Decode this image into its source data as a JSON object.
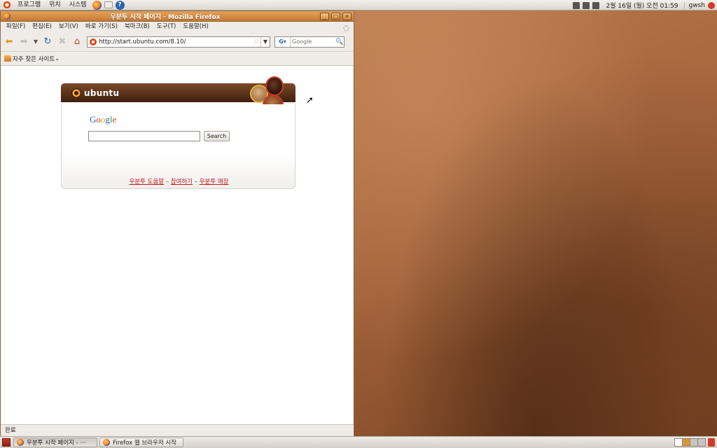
{
  "top_panel": {
    "menus": [
      "프로그램",
      "위치",
      "시스템"
    ],
    "clock": "2월 16일 (월) 오전 01:59",
    "user": "gwsh"
  },
  "window": {
    "title": "우분투 시작 페이지 - Mozilla Firefox",
    "menubar": [
      "파일(F)",
      "편집(E)",
      "보기(V)",
      "바로 가기(S)",
      "북마크(B)",
      "도구(T)",
      "도움말(H)"
    ],
    "url": "http://start.ubuntu.com/8.10/",
    "search_placeholder": "Google",
    "search_engine": "G",
    "bookmarks_label": "자주 찾은 사이트",
    "status": "완료"
  },
  "start_page": {
    "brand": "ubuntu",
    "google_letters": [
      "G",
      "o",
      "o",
      "g",
      "l",
      "e"
    ],
    "search_button": "Search",
    "links": [
      "우분투 도움말",
      "참여하기",
      "우분투 매장"
    ],
    "separator": "–"
  },
  "taskbar": {
    "tasks": [
      "우분투 시작 페이지 - ···",
      "Firefox 웹 브라우저 시작"
    ]
  }
}
